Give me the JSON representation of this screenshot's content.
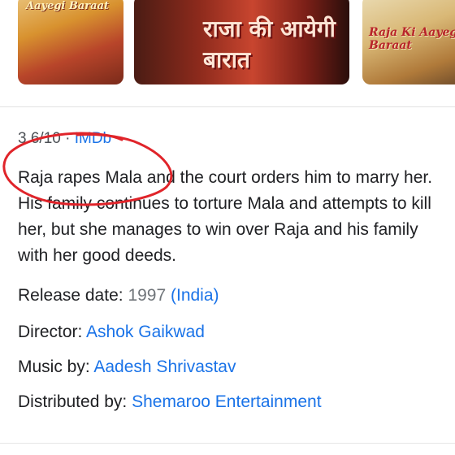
{
  "thumbnails": [
    {
      "caption": "Aayegi Baraat"
    },
    {
      "caption": "राजा की आयेगी बारात"
    },
    {
      "caption": "Raja Ki Aayegi Baraat"
    }
  ],
  "rating": {
    "score": "3.6/10",
    "separator": "·",
    "source": "IMDb"
  },
  "description": "Raja rapes Mala and the court orders him to marry her. His family continues to torture Mala and attempts to kill her, but she manages to win over Raja and his family with her good deeds.",
  "details": {
    "release": {
      "label": "Release date:",
      "year": "1997",
      "country": "(India)"
    },
    "director": {
      "label": "Director:",
      "value": "Ashok Gaikwad"
    },
    "music": {
      "label": "Music by:",
      "value": "Aadesh Shrivastav"
    },
    "distributor": {
      "label": "Distributed by:",
      "value": "Shemaroo Entertainment"
    }
  },
  "colors": {
    "link": "#1a73e8",
    "annotation": "#e0242a"
  }
}
